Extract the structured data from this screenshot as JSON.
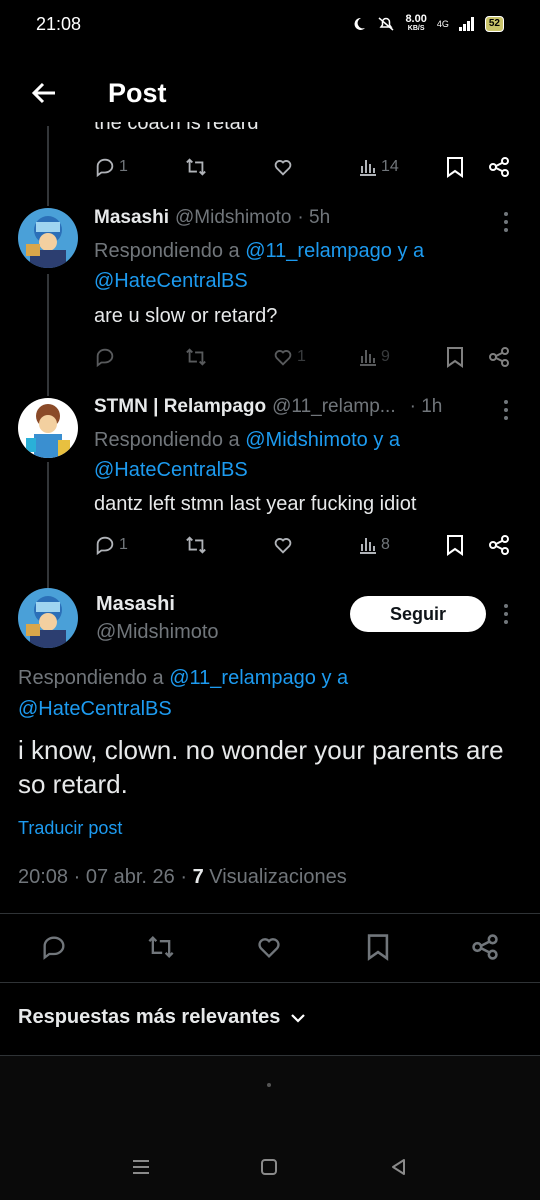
{
  "status_bar": {
    "time": "21:08",
    "net_speed": "8.00",
    "net_unit": "KB/S",
    "network": "4G",
    "battery": "52"
  },
  "header": {
    "title": "Post"
  },
  "thread": {
    "clipped_text": "the coach is retard",
    "top_actions": {
      "replies": "1",
      "views": "14"
    },
    "replies": [
      {
        "name": "Masashi",
        "handle": "@Midshimoto",
        "time": "· 5h",
        "responding_prefix": "Respondiendo a ",
        "mention_1": "@11_relampago",
        "joiner": " y a",
        "mention_2": "@HateCentralBS",
        "text": "are u slow or retard?",
        "likes": "1",
        "views": "9"
      },
      {
        "name": "STMN | Relampago",
        "handle": "@11_relamp...",
        "time": "· 1h",
        "responding_prefix": "Respondiendo a ",
        "mention_1": "@Midshimoto",
        "joiner": " y a",
        "mention_2": "@HateCentralBS",
        "text": "dantz left stmn last year fucking idiot",
        "replies": "1",
        "views": "8"
      }
    ]
  },
  "main_post": {
    "name": "Masashi",
    "handle": "@Midshimoto",
    "follow_label": "Seguir",
    "responding_prefix": "Respondiendo a ",
    "mention_1": "@11_relampago",
    "joiner": " y a",
    "mention_2": "@HateCentralBS",
    "text": "i know, clown. no wonder your parents are so retard.",
    "translate_label": "Traducir post",
    "timestamp": "20:08 · 07 abr. 26 · ",
    "view_count": "7",
    "views_label": " Visualizaciones"
  },
  "sort": {
    "label": "Respuestas más relevantes"
  },
  "colors": {
    "accent": "#1d9bf0",
    "muted": "#71767b",
    "background": "#000000"
  },
  "icons": [
    "back-arrow-icon",
    "reply-icon",
    "repost-icon",
    "like-icon",
    "views-icon",
    "bookmark-icon",
    "share-icon",
    "more-icon",
    "chevron-down-icon"
  ]
}
